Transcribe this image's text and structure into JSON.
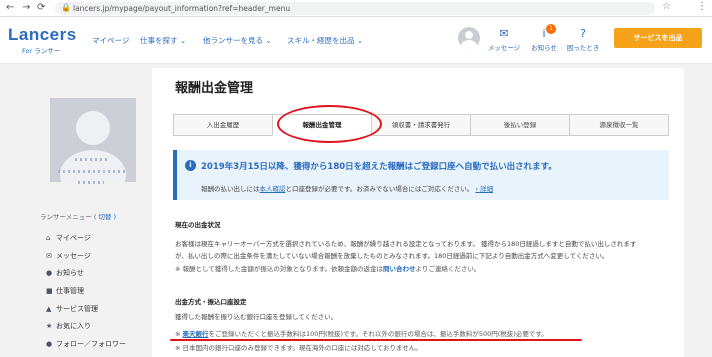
{
  "browser": {
    "back": "←",
    "forward": "→",
    "reload": "⟳",
    "lock": "🔒",
    "url": "lancers.jp/mypage/payout_information?ref=header_menu",
    "star": "☆",
    "menu": "⋮"
  },
  "header": {
    "logo": "Lancers",
    "logo_sub": "For ランサー",
    "nav": [
      "マイページ",
      "仕事を探す ⌄",
      "他ランサーを見る ⌄",
      "スキル・経歴を出品 ⌄"
    ],
    "icons": [
      {
        "icon": "message-icon",
        "glyph": "✉",
        "label": "メッセージ"
      },
      {
        "icon": "bell-icon",
        "glyph": "i",
        "label": "お知らせ"
      },
      {
        "icon": "help-icon",
        "glyph": "?",
        "label": "困ったとき"
      }
    ],
    "badge_count": "1",
    "post_button": "サービスを出品"
  },
  "sidebar": {
    "menu_heading": "ランサーメニュー",
    "menu_toggle": "( 切替 )",
    "items": [
      {
        "icon": "home-icon",
        "glyph": "⌂",
        "label": "マイページ"
      },
      {
        "icon": "message-icon",
        "glyph": "✉",
        "label": "メッセージ"
      },
      {
        "icon": "bell-icon",
        "glyph": "●",
        "label": "お知らせ"
      },
      {
        "icon": "briefcase-icon",
        "glyph": "■",
        "label": "仕事管理"
      },
      {
        "icon": "service-icon",
        "glyph": "▲",
        "label": "サービス管理"
      },
      {
        "icon": "star-icon",
        "glyph": "★",
        "label": "お気に入り"
      },
      {
        "icon": "users-icon",
        "glyph": "●",
        "label": "フォロー／フォロワー"
      }
    ]
  },
  "main": {
    "title": "報酬出金管理",
    "tabs": [
      "入出金履歴",
      "報酬出金管理",
      "領収書・請求書発行",
      "後払い登録",
      "源泉徴収一覧"
    ],
    "active_tab": "報酬出金管理",
    "notice": {
      "icon": "i",
      "title": "2019年3月15日以降、獲得から180日を超えた報酬はご登録口座へ自動で払い出されます。",
      "text_before": "報酬の払い出しには",
      "link1": "本人確認",
      "text_after": "と口座登録が必要です。お済みでない場合にはご対応ください。",
      "more_link": "› 詳細"
    },
    "status": {
      "title": "現在の出金状況",
      "line1": "お客様は現在キャリーオーバー方式を選択されているため、報酬が繰り越される設定となっております。 獲得から180日経過しますと自動で払い出しされます",
      "line2": "が、払い出しの際に出金条件を満たしていない場合報酬を放棄したものとみなされます。180日経過前に下記より自動出金方式へ変更してください。",
      "note_before": "※ 報酬として獲得した金額が振込の対象となります。依頼金額の返金は",
      "note_link": "問い合わせ",
      "note_after": "よりご連絡ください。"
    },
    "payout": {
      "title": "出金方式・振込口座設定",
      "line1": "獲得した報酬を振り込む銀行口座を登録してください。",
      "note_prefix": "※",
      "note_link": "楽天銀行",
      "note_text": "をご登録いただくと振込手数料は100円(税抜)です。それ以外の銀行の場合は、振込手数料が500円(税抜)必要です。",
      "note2": "※ 日本国内の銀行口座のみ登録できます。現在海外の口座には対応しておりません。"
    }
  },
  "colors": {
    "brand_blue": "#2a6cbf",
    "accent_orange": "#f7a21b",
    "annotation_red": "#e0141c"
  }
}
